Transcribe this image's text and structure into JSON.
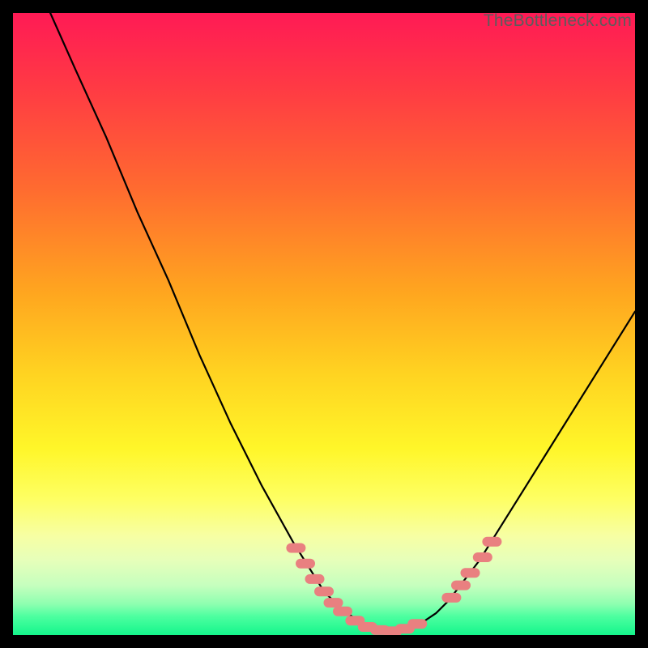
{
  "watermark": "TheBottleneck.com",
  "colors": {
    "page_bg": "#000000",
    "curve": "#000000",
    "marker_fill": "#e98080",
    "marker_stroke": "#d86f6f"
  },
  "chart_data": {
    "type": "line",
    "title": "",
    "xlabel": "",
    "ylabel": "",
    "xlim": [
      0,
      100
    ],
    "ylim": [
      0,
      100
    ],
    "grid": false,
    "series": [
      {
        "name": "bottleneck-curve",
        "x": [
          6,
          10,
          15,
          20,
          25,
          30,
          35,
          40,
          45,
          50,
          53,
          56,
          58,
          60,
          62,
          65,
          68,
          70,
          75,
          80,
          85,
          90,
          95,
          100
        ],
        "y": [
          100,
          91,
          80,
          68,
          57,
          45,
          34,
          24,
          15,
          7,
          4,
          2,
          1,
          0.6,
          0.6,
          1.5,
          3.5,
          5.5,
          12,
          20,
          28,
          36,
          44,
          52
        ]
      }
    ],
    "markers": {
      "name": "highlight-band",
      "points": [
        {
          "x": 45.5,
          "y": 14
        },
        {
          "x": 47.0,
          "y": 11.5
        },
        {
          "x": 48.5,
          "y": 9
        },
        {
          "x": 50.0,
          "y": 7
        },
        {
          "x": 51.5,
          "y": 5.2
        },
        {
          "x": 53.0,
          "y": 3.8
        },
        {
          "x": 55.0,
          "y": 2.3
        },
        {
          "x": 57.0,
          "y": 1.3
        },
        {
          "x": 59.0,
          "y": 0.8
        },
        {
          "x": 61.0,
          "y": 0.6
        },
        {
          "x": 63.0,
          "y": 1.0
        },
        {
          "x": 65.0,
          "y": 1.8
        },
        {
          "x": 70.5,
          "y": 6.0
        },
        {
          "x": 72.0,
          "y": 8.0
        },
        {
          "x": 73.5,
          "y": 10.0
        },
        {
          "x": 75.5,
          "y": 12.5
        },
        {
          "x": 77.0,
          "y": 15.0
        }
      ]
    }
  }
}
